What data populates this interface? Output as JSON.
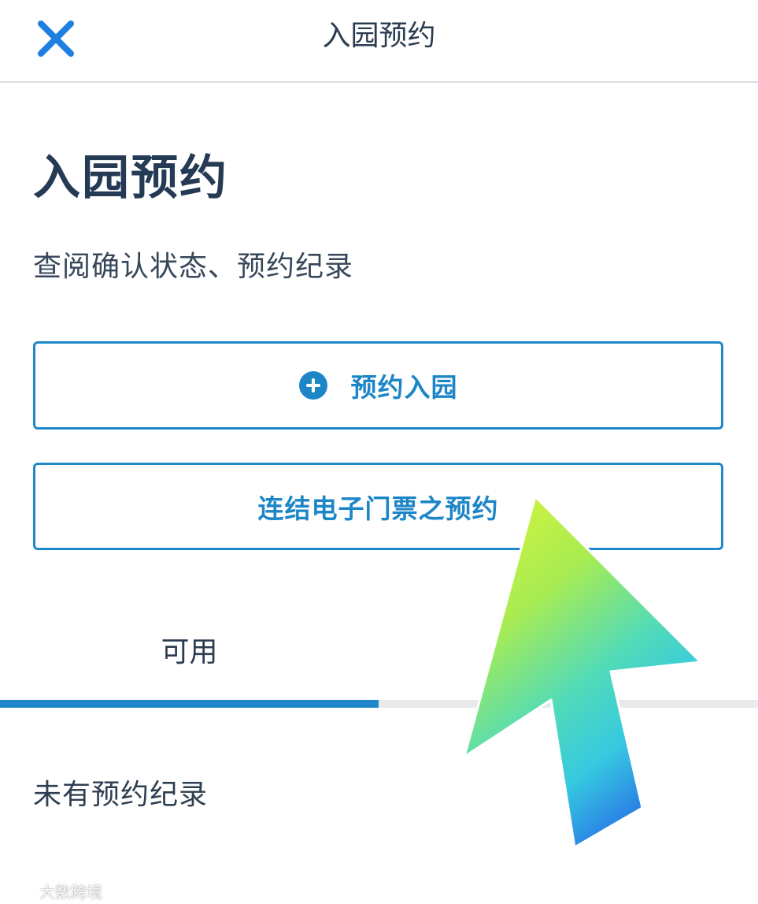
{
  "header": {
    "title": "入园预约",
    "close_icon": "close-icon"
  },
  "main": {
    "title": "入园预约",
    "subtitle": "查阅确认状态、预约纪录",
    "reserve_button": {
      "icon": "plus-circle-icon",
      "label": "预约入园"
    },
    "link_button": {
      "label": "连结电子门票之预约"
    },
    "tabs": [
      {
        "label": "可用",
        "active": true
      }
    ],
    "empty_message": "未有预约纪录"
  },
  "overlay": {
    "arrow_icon": "pointer-arrow-icon",
    "gradient_colors": [
      "#d8f23a",
      "#8fe66a",
      "#3ad1d8",
      "#2a86e6"
    ]
  },
  "watermark": {
    "text": "大数跨境"
  },
  "colors": {
    "accent": "#1c86c7",
    "title_text": "#253a54",
    "divider": "#d9dde2",
    "tab_track": "#e7e9eb"
  }
}
